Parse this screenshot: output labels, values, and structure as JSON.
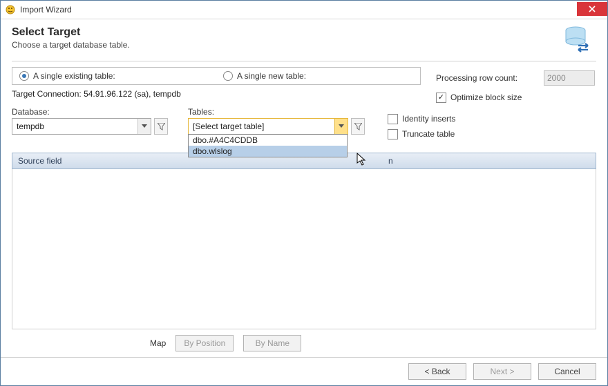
{
  "window": {
    "title": "Import Wizard"
  },
  "header": {
    "title": "Select Target",
    "subtitle": "Choose a target database table."
  },
  "radios": {
    "existing": "A single existing table:",
    "new": "A single new table:"
  },
  "target_connection": {
    "label_full": "Target Connection: 54.91.96.122 (sa), tempdb"
  },
  "processing": {
    "label": "Processing row count:",
    "value": "2000"
  },
  "optimize": {
    "label": "Optimize block size",
    "checked": "✓"
  },
  "database": {
    "label": "Database:",
    "value": "tempdb"
  },
  "tables": {
    "label": "Tables:",
    "placeholder": "[Select target table]",
    "options": {
      "0": "dbo.#A4C4CDDB",
      "1": "dbo.wlslog"
    }
  },
  "flags": {
    "identity": "Identity inserts",
    "truncate": "Truncate table"
  },
  "grid": {
    "col1": "Source field",
    "col2_suffix": "n"
  },
  "map": {
    "label": "Map",
    "by_position": "By Position",
    "by_name": "By Name"
  },
  "footer": {
    "back": "< Back",
    "next": "Next >",
    "cancel": "Cancel"
  }
}
